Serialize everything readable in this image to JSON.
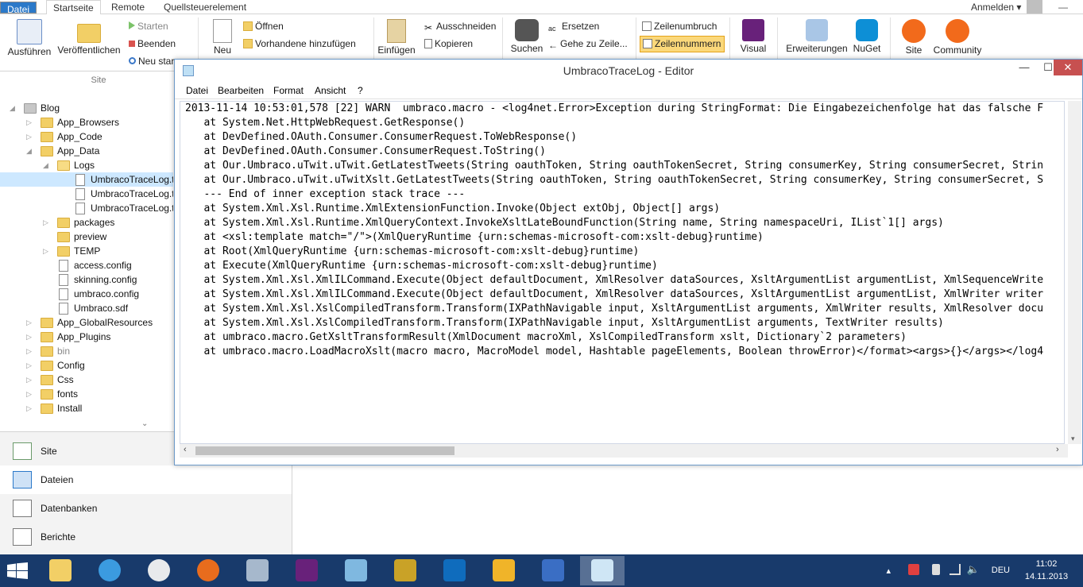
{
  "ribbon": {
    "tabs": [
      "Datei",
      "Startseite",
      "Remote",
      "Quellsteuerelement"
    ],
    "signin": "Anmelden",
    "buttons": {
      "run": "Ausführen",
      "publish": "Veröffentlichen",
      "start": "Starten",
      "stop": "Beenden",
      "new_start": "Neu star",
      "new": "Neu",
      "open": "Öffnen",
      "add_existing": "Vorhandene hinzufügen",
      "paste": "Einfügen",
      "cut": "Ausschneiden",
      "copy": "Kopieren",
      "search": "Suchen",
      "replace": "Ersetzen",
      "goto_line": "Gehe zu Zeile...",
      "word_wrap": "Zeilenumbruch",
      "line_numbers": "Zeilennummern",
      "visual": "Visual",
      "extensions": "Erweiterungen",
      "nuget": "NuGet",
      "site": "Site",
      "community": "Community"
    },
    "group_site": "Site"
  },
  "tree": [
    {
      "label": "Blog",
      "indent": 0,
      "kind": "grey",
      "arrow": "open"
    },
    {
      "label": "App_Browsers",
      "indent": 1,
      "kind": "folder",
      "arrow": "closed"
    },
    {
      "label": "App_Code",
      "indent": 1,
      "kind": "folder",
      "arrow": "closed"
    },
    {
      "label": "App_Data",
      "indent": 1,
      "kind": "folder",
      "arrow": "open"
    },
    {
      "label": "Logs",
      "indent": 2,
      "kind": "folder-open",
      "arrow": "open"
    },
    {
      "label": "UmbracoTraceLog.txt",
      "indent": 3,
      "kind": "file",
      "arrow": "",
      "selected": true
    },
    {
      "label": "UmbracoTraceLog.txt",
      "indent": 3,
      "kind": "file",
      "arrow": ""
    },
    {
      "label": "UmbracoTraceLog.txt",
      "indent": 3,
      "kind": "file",
      "arrow": ""
    },
    {
      "label": "packages",
      "indent": 2,
      "kind": "folder",
      "arrow": "closed"
    },
    {
      "label": "preview",
      "indent": 2,
      "kind": "folder",
      "arrow": ""
    },
    {
      "label": "TEMP",
      "indent": 2,
      "kind": "folder",
      "arrow": "closed"
    },
    {
      "label": "access.config",
      "indent": 2,
      "kind": "file",
      "arrow": ""
    },
    {
      "label": "skinning.config",
      "indent": 2,
      "kind": "file",
      "arrow": ""
    },
    {
      "label": "umbraco.config",
      "indent": 2,
      "kind": "file",
      "arrow": ""
    },
    {
      "label": "Umbraco.sdf",
      "indent": 2,
      "kind": "file",
      "arrow": ""
    },
    {
      "label": "App_GlobalResources",
      "indent": 1,
      "kind": "folder",
      "arrow": "closed"
    },
    {
      "label": "App_Plugins",
      "indent": 1,
      "kind": "folder",
      "arrow": "closed"
    },
    {
      "label": "bin",
      "indent": 1,
      "kind": "folder",
      "arrow": "closed",
      "muted": true
    },
    {
      "label": "Config",
      "indent": 1,
      "kind": "folder",
      "arrow": "closed"
    },
    {
      "label": "Css",
      "indent": 1,
      "kind": "folder",
      "arrow": "closed"
    },
    {
      "label": "fonts",
      "indent": 1,
      "kind": "folder",
      "arrow": "closed"
    },
    {
      "label": "Install",
      "indent": 1,
      "kind": "folder",
      "arrow": "closed"
    }
  ],
  "nav": [
    {
      "label": "Site",
      "selected": false
    },
    {
      "label": "Dateien",
      "selected": true
    },
    {
      "label": "Datenbanken",
      "selected": false
    },
    {
      "label": "Berichte",
      "selected": false
    }
  ],
  "editor": {
    "title": "UmbracoTraceLog - Editor",
    "menu": [
      "Datei",
      "Bearbeiten",
      "Format",
      "Ansicht",
      "?"
    ],
    "lines": [
      "2013-11-14 10:53:01,578 [22] WARN  umbraco.macro - <log4net.Error>Exception during StringFormat: Die Eingabezeichenfolge hat das falsche F",
      "   at System.Net.HttpWebRequest.GetResponse()",
      "   at DevDefined.OAuth.Consumer.ConsumerRequest.ToWebResponse()",
      "   at DevDefined.OAuth.Consumer.ConsumerRequest.ToString()",
      "   at Our.Umbraco.uTwit.uTwit.GetLatestTweets(String oauthToken, String oauthTokenSecret, String consumerKey, String consumerSecret, Strin",
      "   at Our.Umbraco.uTwit.uTwitXslt.GetLatestTweets(String oauthToken, String oauthTokenSecret, String consumerKey, String consumerSecret, S",
      "   --- End of inner exception stack trace ---",
      "   at System.Xml.Xsl.Runtime.XmlExtensionFunction.Invoke(Object extObj, Object[] args)",
      "   at System.Xml.Xsl.Runtime.XmlQueryContext.InvokeXsltLateBoundFunction(String name, String namespaceUri, IList`1[] args)",
      "   at <xsl:template match=\"/\">(XmlQueryRuntime {urn:schemas-microsoft-com:xslt-debug}runtime)",
      "   at Root(XmlQueryRuntime {urn:schemas-microsoft-com:xslt-debug}runtime)",
      "   at Execute(XmlQueryRuntime {urn:schemas-microsoft-com:xslt-debug}runtime)",
      "   at System.Xml.Xsl.XmlILCommand.Execute(Object defaultDocument, XmlResolver dataSources, XsltArgumentList argumentList, XmlSequenceWrite",
      "   at System.Xml.Xsl.XmlILCommand.Execute(Object defaultDocument, XmlResolver dataSources, XsltArgumentList argumentList, XmlWriter writer",
      "   at System.Xml.Xsl.XslCompiledTransform.Transform(IXPathNavigable input, XsltArgumentList arguments, XmlWriter results, XmlResolver docu",
      "   at System.Xml.Xsl.XslCompiledTransform.Transform(IXPathNavigable input, XsltArgumentList arguments, TextWriter results)",
      "   at umbraco.macro.GetXsltTransformResult(XmlDocument macroXml, XslCompiledTransform xslt, Dictionary`2 parameters)",
      "   at umbraco.macro.LoadMacroXslt(macro macro, MacroModel model, Hashtable pageElements, Boolean throwError)</format><args>{}</args></log4"
    ]
  },
  "taskbar": {
    "apps": [
      "file-explorer-icon",
      "internet-explorer-icon",
      "chrome-icon",
      "firefox-icon",
      "webmatrix-icon",
      "visual-studio-icon",
      "photo-viewer-icon",
      "tools-icon",
      "outlook-icon",
      "keys-icon",
      "messenger-icon",
      "notepad-icon"
    ],
    "lang": "DEU",
    "time": "11:02",
    "date": "14.11.2013"
  },
  "colors": {
    "accent": "#2b79c9",
    "taskbar": "#183a6b",
    "folder": "#f2cf66"
  }
}
